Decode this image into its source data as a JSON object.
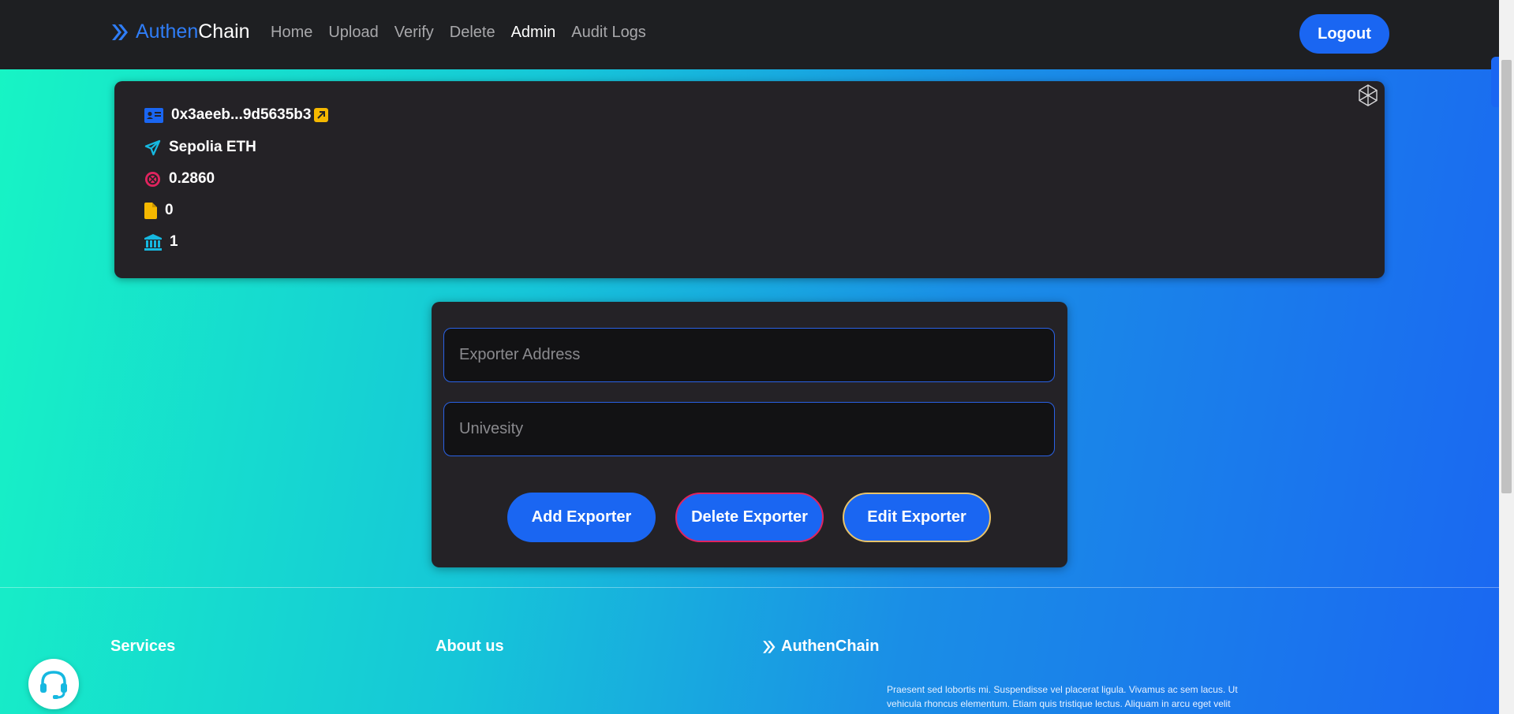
{
  "navbar": {
    "brand_part1": "Authen",
    "brand_part2": "Chain",
    "links": [
      "Home",
      "Upload",
      "Verify",
      "Delete",
      "Admin",
      "Audit Logs"
    ],
    "active_link": "Admin",
    "logout_label": "Logout"
  },
  "info": {
    "address": "0x3aeeb...9d5635b3",
    "network": "Sepolia ETH",
    "balance": "0.2860",
    "documents": "0",
    "institutions": "1",
    "icons": [
      "id-card-icon",
      "send-icon",
      "coin-icon",
      "file-icon",
      "bank-icon",
      "ethereum-icon"
    ]
  },
  "form": {
    "exporter_address_placeholder": "Exporter Address",
    "university_placeholder": "Univesity",
    "add_label": "Add Exporter",
    "delete_label": "Delete Exporter",
    "edit_label": "Edit Exporter"
  },
  "footer": {
    "services": "Services",
    "about": "About us",
    "brand": "AuthenChain",
    "text": "Praesent sed lobortis mi. Suspendisse vel placerat ligula. Vivamus ac sem lacus. Ut vehicula rhoncus elementum. Etiam quis tristique lectus. Aliquam in arcu eget velit"
  },
  "colors": {
    "primary": "#1a66f2",
    "card": "#242226",
    "navbar": "#1e1f22",
    "delete_border": "#e0245e",
    "edit_border": "#e8c36a"
  }
}
